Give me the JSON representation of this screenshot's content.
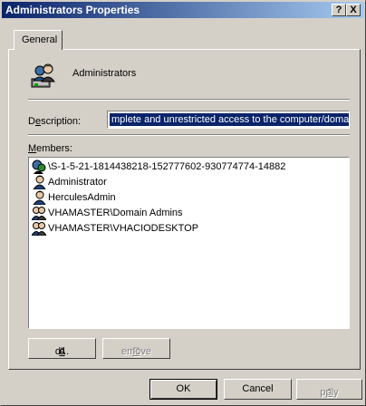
{
  "window": {
    "title": "Administrators Properties",
    "help_label": "?",
    "close_label": "X"
  },
  "tabs": [
    {
      "label": "General",
      "active": true
    }
  ],
  "group": {
    "name": "Administrators",
    "icon": "group-icon"
  },
  "description": {
    "label_pre": "D",
    "label_u": "e",
    "label_post": "scription:",
    "value": "mplete and unrestricted access to the computer/domain"
  },
  "members": {
    "label_u": "M",
    "label_post": "embers:",
    "items": [
      {
        "name": "\\S-1-5-21-1814438218-152777602-930774774-14882",
        "icon": "unknown-account-icon"
      },
      {
        "name": "Administrator",
        "icon": "user-icon"
      },
      {
        "name": "HerculesAdmin",
        "icon": "user-icon"
      },
      {
        "name": "VHAMASTER\\Domain Admins",
        "icon": "group-icon"
      },
      {
        "name": "VHAMASTER\\VHACIODESKTOP",
        "icon": "group-icon"
      }
    ]
  },
  "buttons": {
    "add": {
      "pre": "A",
      "u": "d",
      "post": "d..."
    },
    "remove": {
      "pre": "",
      "u": "R",
      "post": "emove",
      "disabled": true
    },
    "ok": "OK",
    "cancel": "Cancel",
    "apply": {
      "pre": "",
      "u": "A",
      "post": "pply",
      "disabled": true
    }
  },
  "colors": {
    "titlebar_start": "#0a246a",
    "titlebar_end": "#a6caf0",
    "face": "#d4d0c8",
    "selection": "#0a246a"
  }
}
